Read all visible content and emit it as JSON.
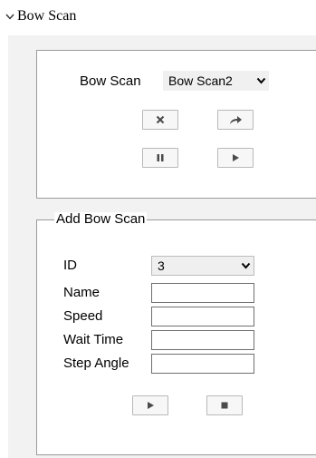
{
  "section": {
    "title": "Bow Scan",
    "expanded": true,
    "chevron_icon": "chevron-down-icon"
  },
  "control_panel": {
    "label": "Bow Scan",
    "selected": "Bow Scan2",
    "buttons": [
      {
        "name": "delete-button",
        "icon": "close-icon"
      },
      {
        "name": "call-button",
        "icon": "redo-arrow-icon"
      },
      {
        "name": "pause-button",
        "icon": "pause-icon"
      },
      {
        "name": "start-button",
        "icon": "play-icon"
      }
    ]
  },
  "add_form": {
    "legend": "Add Bow Scan",
    "fields": [
      {
        "label": "ID",
        "type": "select",
        "value": "3"
      },
      {
        "label": "Name",
        "type": "text",
        "value": ""
      },
      {
        "label": "Speed",
        "type": "text",
        "value": ""
      },
      {
        "label": "Wait Time",
        "type": "text",
        "value": ""
      },
      {
        "label": "Step Angle",
        "type": "text",
        "value": ""
      }
    ],
    "buttons": [
      {
        "name": "start-record-button",
        "icon": "play-icon"
      },
      {
        "name": "stop-record-button",
        "icon": "stop-icon"
      }
    ]
  },
  "colors": {
    "panel_bg": "#f2f2f2",
    "border": "#9a9a9a",
    "icon": "#4a4a4a"
  }
}
